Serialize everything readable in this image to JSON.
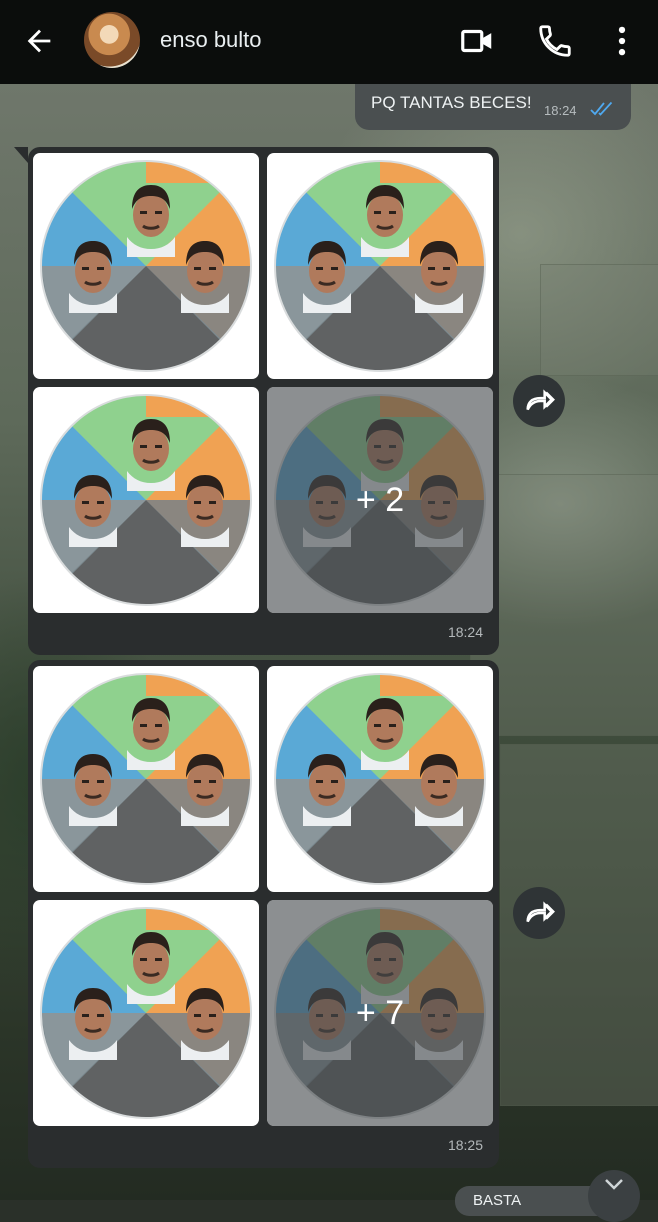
{
  "header": {
    "contact_name": "enso bulto",
    "back_icon": "arrow-left-icon",
    "video_icon": "video-call-icon",
    "call_icon": "phone-icon",
    "menu_icon": "more-vert-icon"
  },
  "messages": {
    "outgoing_text": "PQ TANTAS BECES!",
    "outgoing_time": "18:24",
    "album1": {
      "time": "18:24",
      "more_label": "+ 2"
    },
    "album2": {
      "time": "18:25",
      "more_label": "+ 7"
    },
    "peek_text": "BASTA"
  },
  "colors": {
    "accent_ticks": "#4fa9f0",
    "ring_green": "#8fd18e",
    "ring_blue": "#5aa9d6",
    "ring_orange": "#f0a253",
    "bubble_dark": "#2a2d2e"
  }
}
